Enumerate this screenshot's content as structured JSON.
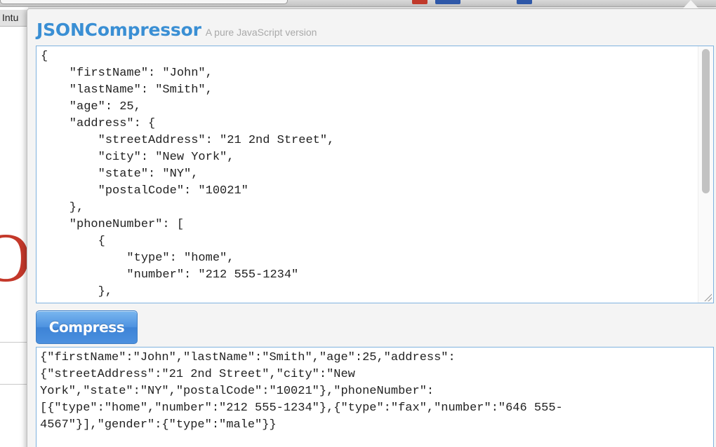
{
  "background": {
    "tab_label": "Intu"
  },
  "popup": {
    "title": "JSONCompressor",
    "subtitle": "A pure JavaScript version",
    "input_text": "{\n    \"firstName\": \"John\",\n    \"lastName\": \"Smith\",\n    \"age\": 25,\n    \"address\": {\n        \"streetAddress\": \"21 2nd Street\",\n        \"city\": \"New York\",\n        \"state\": \"NY\",\n        \"postalCode\": \"10021\"\n    },\n    \"phoneNumber\": [\n        {\n            \"type\": \"home\",\n            \"number\": \"212 555-1234\"\n        },",
    "compress_label": "Compress",
    "output_text": "{\"firstName\":\"John\",\"lastName\":\"Smith\",\"age\":25,\"address\":\n{\"streetAddress\":\"21 2nd Street\",\"city\":\"New\nYork\",\"state\":\"NY\",\"postalCode\":\"10021\"},\"phoneNumber\":\n[{\"type\":\"home\",\"number\":\"212 555-1234\"},{\"type\":\"fax\",\"number\":\"646 555-\n4567\"}],\"gender\":{\"type\":\"male\"}}"
  },
  "colors": {
    "title": "#3a8fd4",
    "button": "#4d92e0",
    "textbox_border": "#7fb2df"
  }
}
